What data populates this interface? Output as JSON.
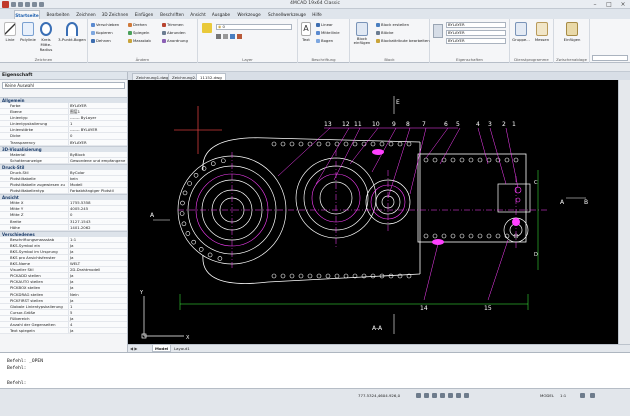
{
  "window": {
    "title": "4MCAD 19x64 Classic"
  },
  "menu_tabs": [
    "Startseite",
    "Bearbeiten",
    "Zeichnen",
    "3D Zeichnen",
    "Einfügen",
    "Beschriften",
    "Ansicht",
    "Ausgabe",
    "Werkzeuge",
    "Schnellwerkzeuge",
    "Hilfe"
  ],
  "ribbon": {
    "groups": [
      "Zeichnen",
      "Ändern",
      "Layer",
      "Beschriftung",
      "Block",
      "Eigenschaften",
      "Dienstprogramme",
      "Zwischenablage"
    ],
    "draw_items": [
      "Linie",
      "Polylinie",
      "Kreis",
      "Mitte-Radius",
      "3-Punkt-Bogen"
    ],
    "modify_items": [
      "Verschieben",
      "Kopieren",
      "Dehnen",
      "Drehen",
      "Spiegeln",
      "Massstab",
      "Trimmen",
      "Abrunden",
      "Anordnung"
    ],
    "layer_value": "0",
    "annotation_items": [
      "Text",
      "Linear",
      "Mittellinie",
      "Bogen"
    ],
    "block_items": [
      "Block einfügen",
      "Block erstellen",
      "Blöcke",
      "Blockattribute bearbeiten"
    ],
    "prop_values": [
      "BYLAYER",
      "BYLAYER",
      "BYLAYER"
    ],
    "util_items": [
      "Gruppe...",
      "Messen"
    ],
    "clipboard_items": [
      "Einfügen"
    ]
  },
  "file_tabs": [
    "Zeichnung1.dwg",
    "Zeichnung2.dwg",
    "11152.dwg"
  ],
  "properties": {
    "title": "Eigenschaft",
    "selection": "Keine Auswahl",
    "sections": [
      {
        "name": "Allgemein",
        "rows": [
          {
            "k": "Farbe",
            "v": "BYLAYER"
          },
          {
            "k": "Ebene",
            "v": "图层1"
          },
          {
            "k": "Linientyp",
            "v": "------- ByLayer"
          },
          {
            "k": "Linientypskalierung",
            "v": "1"
          },
          {
            "k": "Linienstärke",
            "v": "------- BYLAYER"
          },
          {
            "k": "Dicke",
            "v": "0"
          },
          {
            "k": "Transparency",
            "v": "BYLAYER"
          }
        ]
      },
      {
        "name": "3D-Visualisierung",
        "rows": [
          {
            "k": "Material",
            "v": "ByBlock"
          },
          {
            "k": "Schattenanzeige",
            "v": "Gewordene und empfangene S..."
          }
        ]
      },
      {
        "name": "Druck-Stil",
        "rows": [
          {
            "k": "Druck-Stil",
            "v": "ByColor"
          },
          {
            "k": "Plotstiltabelle",
            "v": "kein"
          },
          {
            "k": "Plotstiltabelle zugewiesen zu",
            "v": "Modell"
          },
          {
            "k": "Plotstiltabellentyp",
            "v": "Farbabhängiger Plotstil"
          }
        ]
      },
      {
        "name": "Ansicht",
        "rows": [
          {
            "k": "Mitte X",
            "v": "1755.5358"
          },
          {
            "k": "Mitte Y",
            "v": "4005.245"
          },
          {
            "k": "Mitte Z",
            "v": "0"
          },
          {
            "k": "Breite",
            "v": "3127.1543"
          },
          {
            "k": "Höhe",
            "v": "1401.2062"
          }
        ]
      },
      {
        "name": "Verschiedenes",
        "rows": [
          {
            "k": "Beschriftungsmassstab",
            "v": "1:1"
          },
          {
            "k": "BKS-Symbol ein",
            "v": "Ja"
          },
          {
            "k": "BKS-Symbol im Ursprung",
            "v": "Ja"
          },
          {
            "k": "BKS pro Ansichtsfenster",
            "v": "Ja"
          },
          {
            "k": "BKS-Name",
            "v": "WELT"
          },
          {
            "k": "Visueller Stil",
            "v": "2D-Drahtmodell"
          },
          {
            "k": "PICKADD stellen",
            "v": "Ja"
          },
          {
            "k": "PICKAUTO stellen",
            "v": "Ja"
          },
          {
            "k": "PICKBOX stellen",
            "v": "Ja"
          },
          {
            "k": "PICKDRAG stellen",
            "v": "Nein"
          },
          {
            "k": "PICKFIRST stellen",
            "v": "Ja"
          },
          {
            "k": "Globale Linientypskalierung",
            "v": "1"
          },
          {
            "k": "Cursor-Größe",
            "v": "5"
          },
          {
            "k": "Fülbereich",
            "v": "Ja"
          },
          {
            "k": "Anzahl der Gegenseiten",
            "v": "4"
          },
          {
            "k": "Text spiegeln",
            "v": "Ja"
          }
        ]
      }
    ]
  },
  "drawing": {
    "labels": [
      "13",
      "12",
      "11",
      "10",
      "9",
      "8",
      "7",
      "6",
      "5",
      "4",
      "3",
      "2",
      "1",
      "14",
      "15"
    ],
    "section_letters": [
      "E",
      "A",
      "A",
      "B",
      "C",
      "D",
      "A-A"
    ]
  },
  "layout_tabs": [
    "Model",
    "Layout1"
  ],
  "command": {
    "lines": [
      "Befehl: _OPEN",
      "Befehl:",
      "Befehl:"
    ]
  },
  "status": {
    "coords": "777.5324,4604.926,0",
    "items": [
      "MODEL",
      "1:1"
    ]
  }
}
